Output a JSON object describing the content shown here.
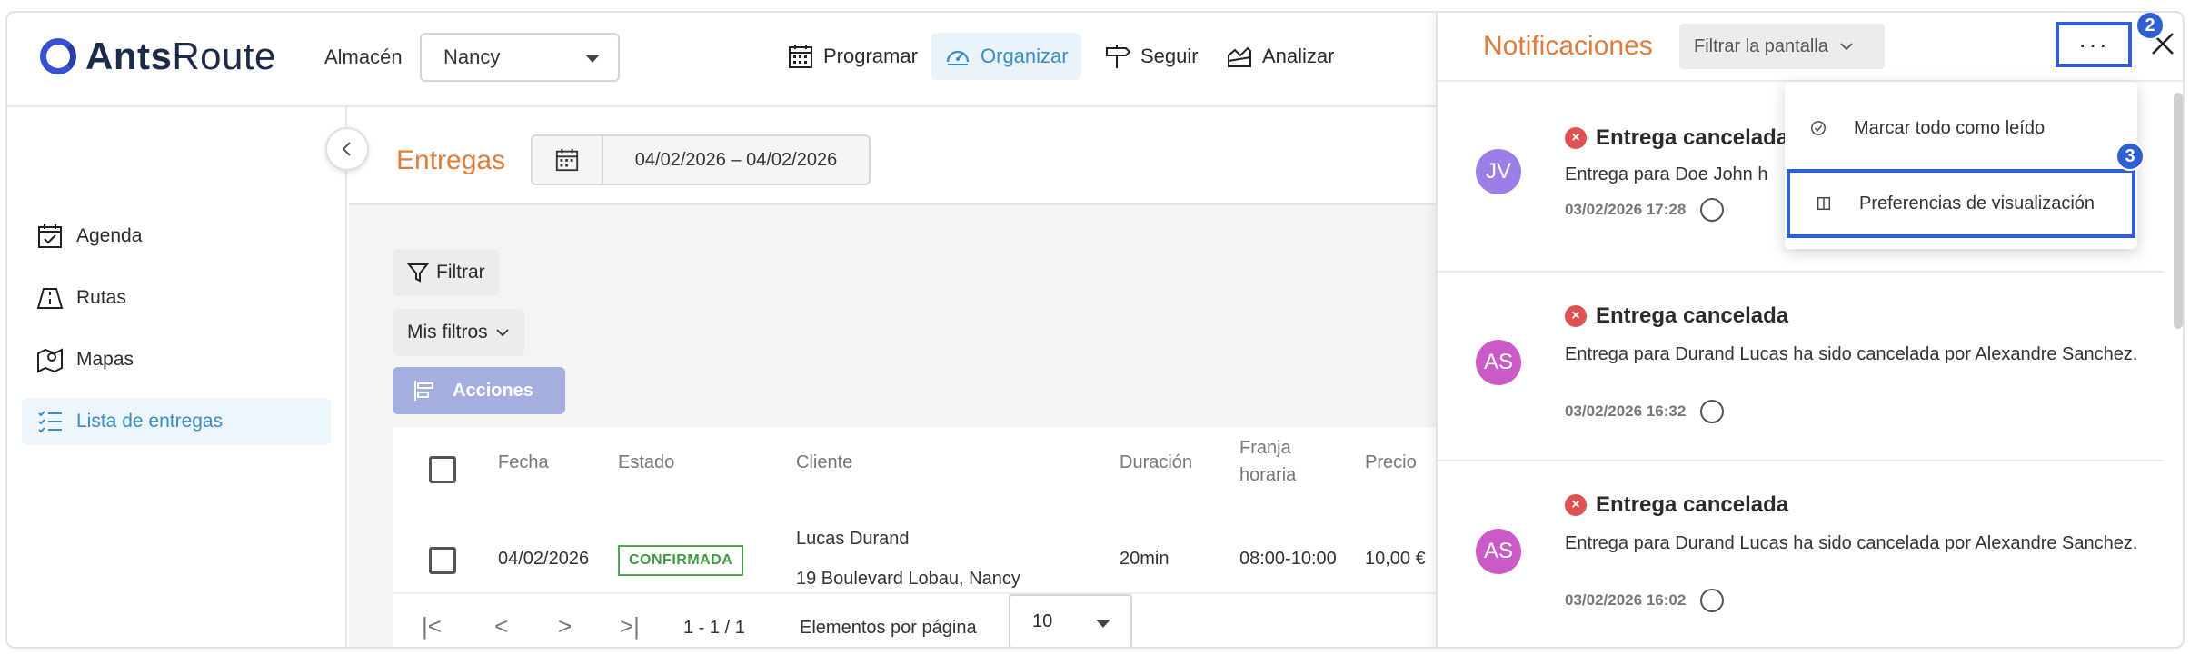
{
  "app": {
    "logo_bold": "Ants",
    "logo_regular": "Route"
  },
  "header": {
    "almacen_label": "Almacén",
    "almacen_value": "Nancy",
    "nav": [
      {
        "label": "Programar",
        "icon": "calendar-grid-icon"
      },
      {
        "label": "Organizar",
        "icon": "gauge-icon",
        "active": true
      },
      {
        "label": "Seguir",
        "icon": "signpost-icon"
      },
      {
        "label": "Analizar",
        "icon": "chart-area-icon"
      }
    ]
  },
  "sidebar": {
    "items": [
      {
        "label": "Agenda",
        "icon": "calendar-check-icon"
      },
      {
        "label": "Rutas",
        "icon": "road-icon"
      },
      {
        "label": "Mapas",
        "icon": "map-pin-icon"
      },
      {
        "label": "Lista de entregas",
        "icon": "list-check-icon",
        "active": true
      }
    ]
  },
  "main": {
    "title": "Entregas",
    "date_range": "04/02/2026 – 04/02/2026",
    "filter_label": "Filtrar",
    "my_filters_label": "Mis filtros",
    "actions_label": "Acciones",
    "columns": [
      "Fecha",
      "Estado",
      "Cliente",
      "Duración",
      "Franja horaria",
      "Precio"
    ],
    "rows": [
      {
        "fecha": "04/02/2026",
        "estado": "CONFIRMADA",
        "cliente_nombre": "Lucas Durand",
        "cliente_direccion": "19 Boulevard Lobau, Nancy",
        "duracion": "20min",
        "franja": "08:00-10:00",
        "precio": "10,00 €"
      }
    ],
    "pagination": {
      "range": "1 - 1 / 1",
      "per_page_label": "Elementos por página",
      "per_page_value": "10"
    }
  },
  "notifications": {
    "title": "Notificaciones",
    "filter_label": "Filtrar la pantalla",
    "more_label": "···",
    "menu": {
      "mark_all_read": "Marcar todo como leído",
      "display_prefs": "Preferencias de visualización"
    },
    "steps": [
      "2",
      "3"
    ],
    "items": [
      {
        "initials": "JV",
        "avatar_color": "#9b7ee6",
        "title": "Entrega cancelada",
        "text": "Entrega para Doe John h",
        "time": "03/02/2026 17:28"
      },
      {
        "initials": "AS",
        "avatar_color": "#c95ac6",
        "title": "Entrega cancelada",
        "text": "Entrega para Durand Lucas ha sido cancelada por Alexandre Sanchez.",
        "time": "03/02/2026 16:32"
      },
      {
        "initials": "AS",
        "avatar_color": "#c95ac6",
        "title": "Entrega cancelada",
        "text": "Entrega para Durand Lucas ha sido cancelada por Alexandre Sanchez.",
        "time": "03/02/2026 16:02"
      }
    ]
  },
  "colors": {
    "accent_orange": "#e07b3a",
    "accent_blue": "#3a8dc6",
    "brand_blue": "#3650d6",
    "annotation_blue": "#2f5fd0",
    "cancel_red": "#e05252",
    "confirm_green": "#3f9a3f"
  }
}
